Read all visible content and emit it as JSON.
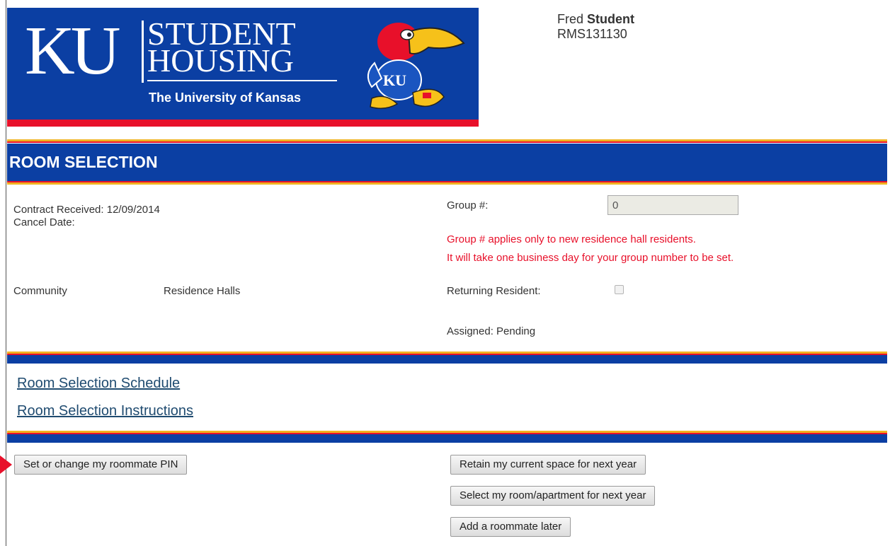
{
  "header": {
    "brand": {
      "ku": "KU",
      "line1": "STUDENT",
      "line2": "HOUSING",
      "subtitle": "The University of Kansas",
      "mascot_badge": "KU"
    },
    "user": {
      "first_name": "Fred",
      "last_name": "Student",
      "id": "RMS131130"
    }
  },
  "section": {
    "title": "ROOM SELECTION"
  },
  "details": {
    "contract_received_label": "Contract Received:",
    "contract_received_value": "12/09/2014",
    "cancel_date_label": "Cancel Date:",
    "community_label": "Community",
    "community_value": "Residence Halls",
    "group_label": "Group #:",
    "group_value": "0",
    "group_note_1": "Group # applies only to new residence hall residents.",
    "group_note_2": "It will take one business day for your group number to be set.",
    "returning_resident_label": "Returning Resident:",
    "returning_resident_checked": false,
    "assigned_label": "Assigned:",
    "assigned_value": "Pending"
  },
  "links": {
    "schedule": "Room Selection Schedule",
    "instructions": "Room Selection Instructions"
  },
  "buttons": {
    "roommate_pin": "Set or change my roommate PIN",
    "retain_space": "Retain my current space for next year",
    "select_room": "Select my room/apartment for next year",
    "add_roommate": "Add a roommate later"
  },
  "colors": {
    "brand_blue": "#0b3fa3",
    "brand_red": "#e8102a",
    "brand_gold": "#f0b320",
    "link": "#1f4b70"
  }
}
